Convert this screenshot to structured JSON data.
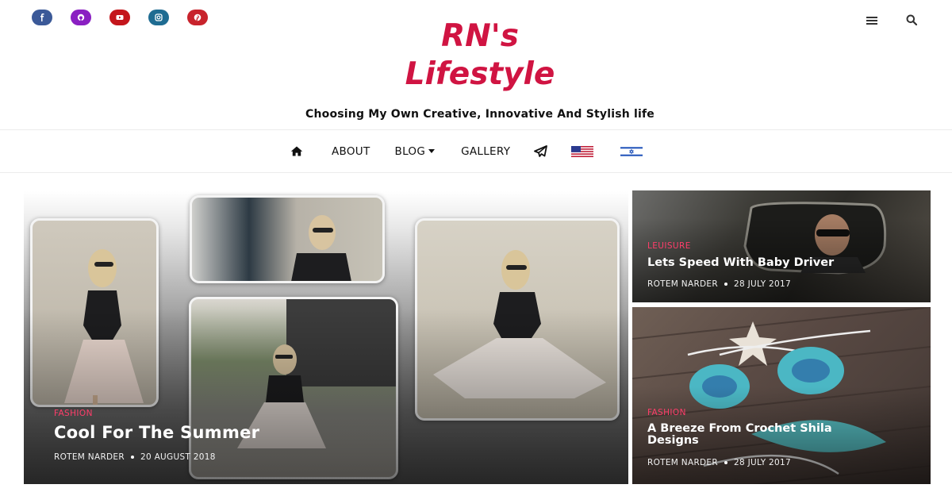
{
  "header": {
    "social": [
      {
        "icon": "facebook-icon",
        "color": "#3b5998"
      },
      {
        "icon": "github-icon",
        "color": "#8a1fc2"
      },
      {
        "icon": "youtube-icon",
        "color": "#c4161c"
      },
      {
        "icon": "instagram-icon",
        "color": "#1f6c92"
      },
      {
        "icon": "pinterest-icon",
        "color": "#c8232c"
      }
    ],
    "logo_line1": "RN's",
    "logo_line2": "Lifestyle",
    "logo_color": "#d01442",
    "tagline": "Choosing My Own Creative, Innovative And Stylish life"
  },
  "nav": {
    "items": [
      "ABOUT",
      "BLOG",
      "GALLERY"
    ],
    "home_icon": "home-icon",
    "send_icon": "paper-plane-icon",
    "flags": [
      "us-flag-icon",
      "israel-flag-icon"
    ]
  },
  "featured": {
    "main": {
      "category": "FASHION",
      "title": "Cool For The Summer",
      "author": "ROTEM NARDER",
      "date": "20 AUGUST 2018"
    },
    "side": [
      {
        "category": "LEUISURE",
        "title": "Lets Speed With Baby Driver",
        "author": "ROTEM NARDER",
        "date": "28 JULY 2017"
      },
      {
        "category": "FASHION",
        "title": "A Breeze From Crochet Shila Designs",
        "author": "ROTEM NARDER",
        "date": "28 JULY 2017"
      }
    ],
    "category_color": "#ff3d6a"
  }
}
